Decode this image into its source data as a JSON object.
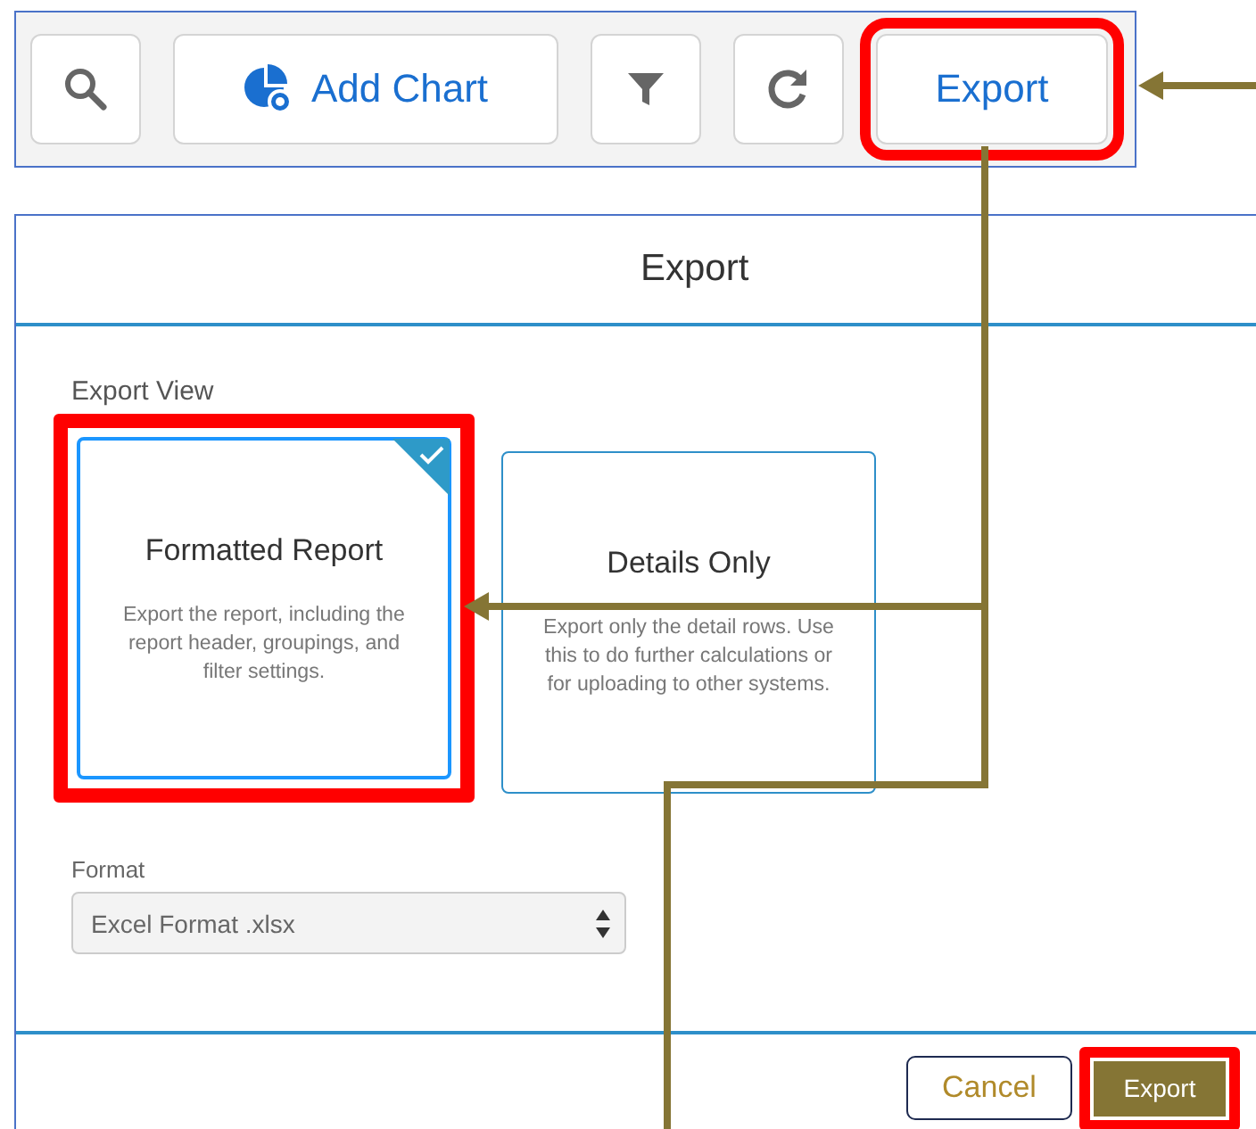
{
  "toolbar": {
    "buttons": [
      {
        "kind": "search"
      },
      {
        "kind": "chart",
        "label": "Add Chart"
      },
      {
        "kind": "filter"
      },
      {
        "kind": "refresh"
      },
      {
        "kind": "text",
        "label": "Export",
        "highlighted": true
      }
    ]
  },
  "dialog": {
    "title": "Export",
    "section_label": "Export View",
    "options": [
      {
        "title": "Formatted Report",
        "description": "Export the report, including the report header, groupings, and filter settings.",
        "selected": true,
        "highlighted": true
      },
      {
        "title": "Details Only",
        "description": "Export only the detail rows. Use this to do further calculations or for uploading to other systems.",
        "selected": false,
        "highlighted": false
      }
    ],
    "format": {
      "label": "Format",
      "value": "Excel Format .xlsx"
    },
    "footer": {
      "cancel": "Cancel",
      "confirm": "Export",
      "confirm_highlighted": true
    }
  }
}
